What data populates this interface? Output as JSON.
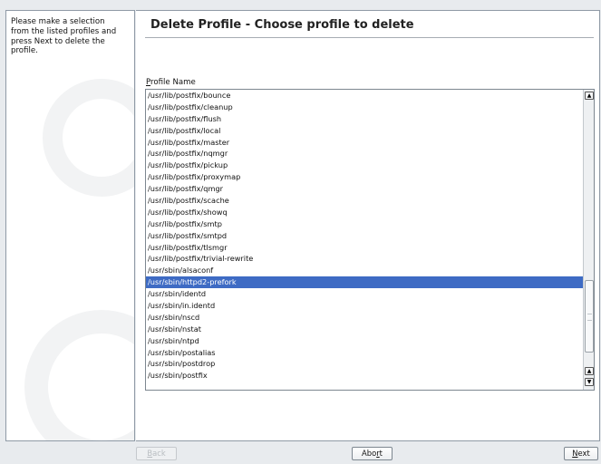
{
  "help": {
    "text": "Please make a selection\nfrom the listed profiles and\npress Next to delete the\nprofile."
  },
  "title": "Delete Profile - Choose profile to delete",
  "list": {
    "label_prefix": "P",
    "label_rest": "rofile Name",
    "selected": "/usr/sbin/httpd2-prefork",
    "items": [
      "/usr/lib/postfix/bounce",
      "/usr/lib/postfix/cleanup",
      "/usr/lib/postfix/flush",
      "/usr/lib/postfix/local",
      "/usr/lib/postfix/master",
      "/usr/lib/postfix/nqmgr",
      "/usr/lib/postfix/pickup",
      "/usr/lib/postfix/proxymap",
      "/usr/lib/postfix/qmgr",
      "/usr/lib/postfix/scache",
      "/usr/lib/postfix/showq",
      "/usr/lib/postfix/smtp",
      "/usr/lib/postfix/smtpd",
      "/usr/lib/postfix/tlsmgr",
      "/usr/lib/postfix/trivial-rewrite",
      "/usr/sbin/alsaconf",
      "/usr/sbin/httpd2-prefork",
      "/usr/sbin/identd",
      "/usr/sbin/in.identd",
      "/usr/sbin/nscd",
      "/usr/sbin/nstat",
      "/usr/sbin/ntpd",
      "/usr/sbin/postalias",
      "/usr/sbin/postdrop",
      "/usr/sbin/postfix"
    ]
  },
  "scrollbar": {
    "up_icon": "arrow-up-icon",
    "down_icon": "arrow-down-icon",
    "up_glyph": "▲",
    "down_glyph": "▼"
  },
  "buttons": {
    "back": {
      "prefix": "B",
      "rest": "ack",
      "enabled": false
    },
    "abort": {
      "prefix": "Abo",
      "underline": "r",
      "rest": "t"
    },
    "next": {
      "prefix": "N",
      "rest": "ext"
    }
  },
  "colors": {
    "selection": "#3e6bc4",
    "background": "#e8ebee"
  }
}
